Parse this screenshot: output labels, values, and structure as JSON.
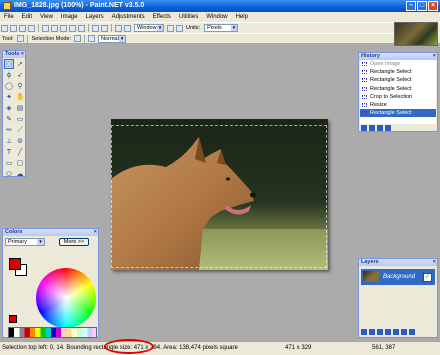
{
  "window": {
    "title": "IMG_1828.jpg (100%) - Paint.NET v3.5.0",
    "controls": [
      "minimize",
      "maximize",
      "close"
    ]
  },
  "menu": [
    "File",
    "Edit",
    "View",
    "Image",
    "Layers",
    "Adjustments",
    "Effects",
    "Utilities",
    "Window",
    "Help"
  ],
  "toolbar": {
    "window_select": "Window",
    "units_label": "Units:",
    "units_value": "Pixels",
    "tool_label": "Tool:",
    "selection_mode_label": "Selection Mode:",
    "blend_value": "Normal"
  },
  "tools_panel": {
    "title": "Tools",
    "tools": [
      "select-rect",
      "move",
      "lasso",
      "move-selection",
      "ellipse-select",
      "zoom",
      "magic-wand",
      "pan",
      "paint-bucket",
      "gradient",
      "paintbrush",
      "eraser",
      "pencil",
      "color-picker",
      "clone-stamp",
      "recolor",
      "text",
      "line",
      "rectangle",
      "rounded-rect",
      "ellipse",
      "freeform"
    ]
  },
  "history_panel": {
    "title": "History",
    "items": [
      {
        "label": "Open Image",
        "state": "ghost"
      },
      {
        "label": "Rectangle Select",
        "state": "normal"
      },
      {
        "label": "Rectangle Select",
        "state": "normal"
      },
      {
        "label": "Rectangle Select",
        "state": "normal"
      },
      {
        "label": "Crop to Selection",
        "state": "normal"
      },
      {
        "label": "Resize",
        "state": "normal"
      },
      {
        "label": "Rectangle Select",
        "state": "selected"
      }
    ]
  },
  "colors_panel": {
    "title": "Colors",
    "mode": "Primary",
    "more_button": "More >>",
    "primary_color": "#d80000",
    "secondary_color": "#ffffff"
  },
  "layers_panel": {
    "title": "Layers",
    "layers": [
      {
        "name": "Background",
        "visible": true
      }
    ]
  },
  "status": {
    "text": "Selection top left: 0, 14. Bounding rectangle size: 471 x 294. Area: 138,474 pixels square",
    "image_size": "471 x 329",
    "cursor_pos": "561, 387"
  },
  "colors": {
    "accent": "#316ac5",
    "highlight_ellipse": "#e00000"
  }
}
